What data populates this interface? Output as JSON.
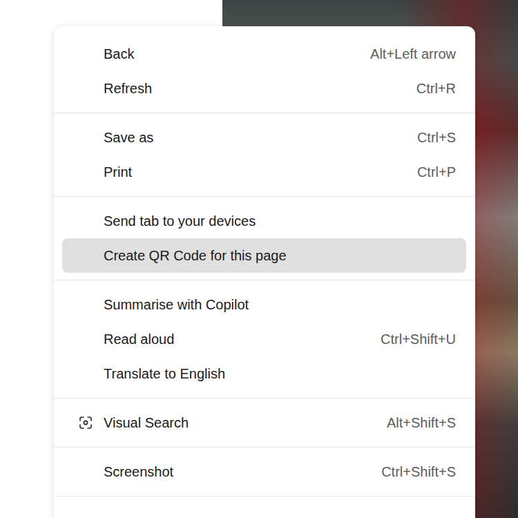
{
  "context_menu": {
    "groups": [
      {
        "items": [
          {
            "label": "Back",
            "shortcut": "Alt+Left arrow",
            "selected": false,
            "kind": "plain"
          },
          {
            "label": "Refresh",
            "shortcut": "Ctrl+R",
            "selected": false,
            "kind": "plain"
          }
        ]
      },
      {
        "items": [
          {
            "label": "Save as",
            "shortcut": "Ctrl+S",
            "selected": false,
            "kind": "plain"
          },
          {
            "label": "Print",
            "shortcut": "Ctrl+P",
            "selected": false,
            "kind": "plain"
          }
        ]
      },
      {
        "items": [
          {
            "label": "Send tab to your devices",
            "shortcut": "",
            "selected": false,
            "kind": "plain"
          },
          {
            "label": "Create QR Code for this page",
            "shortcut": "",
            "selected": true,
            "kind": "plain"
          }
        ]
      },
      {
        "items": [
          {
            "label": "Summarise with Copilot",
            "shortcut": "",
            "selected": false,
            "kind": "plain"
          },
          {
            "label": "Read aloud",
            "shortcut": "Ctrl+Shift+U",
            "selected": false,
            "kind": "plain"
          },
          {
            "label": "Translate to English",
            "shortcut": "",
            "selected": false,
            "kind": "plain"
          }
        ]
      },
      {
        "items": [
          {
            "label": "Visual Search",
            "shortcut": "Alt+Shift+S",
            "selected": false,
            "kind": "with-icon"
          }
        ]
      },
      {
        "items": [
          {
            "label": "Screenshot",
            "shortcut": "Ctrl+Shift+S",
            "selected": false,
            "kind": "plain"
          }
        ]
      }
    ]
  }
}
